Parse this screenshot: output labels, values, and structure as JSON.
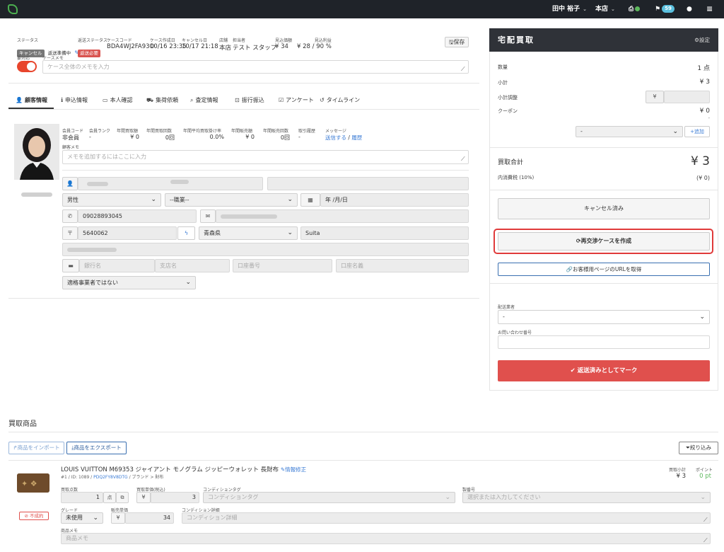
{
  "topbar": {
    "user": "田中 裕子",
    "store": "本店",
    "notify_count": "59"
  },
  "case": {
    "status_label": "ステータス",
    "status_badge": "キャンセル",
    "status_text": "返送準備中",
    "return_status_label": "返送ステータス",
    "return_badge": "返送必要",
    "case_code_label": "ケースコード",
    "case_code": "BDA4WJ2FA93O",
    "created_label": "ケース作成日",
    "created": "10/16 23:35",
    "cancel_label": "キャンセル日",
    "cancel": "10/17 21:18",
    "store_label": "店舗",
    "store": "本店",
    "staff_label": "担当者",
    "staff": "テスト スタッフ",
    "estimate_label": "見込価額",
    "estimate": "¥ 34",
    "estimate_profit_label": "見込利益",
    "estimate_profit": "¥ 28 / 90 %",
    "save_button": "保存",
    "needs_action_label": "要対応",
    "memo_label": "ケースメモ",
    "memo_placeholder": "ケース全体のメモを入力"
  },
  "tabs": [
    "顧客情報",
    "申込情報",
    "本人確認",
    "集荷依頼",
    "査定情報",
    "振行振込",
    "アンケート",
    "タイムライン"
  ],
  "customer": {
    "member_code_label": "会員コード",
    "member_code": "非会員",
    "member_rank_label": "会員ランク",
    "member_rank": "-",
    "yearly_buy_amount_label": "年間買取額",
    "yearly_buy_amount": "¥ 0",
    "yearly_buy_count_label": "年間買取回数",
    "yearly_buy_count": "0回",
    "avg_rate_label": "年間平均買取掛け率",
    "avg_rate": "0.0%",
    "yearly_sale_amount_label": "年間販売額",
    "yearly_sale_amount": "¥ 0",
    "yearly_sale_count_label": "年間販売回数",
    "yearly_sale_count": "0回",
    "history_label": "取引履歴",
    "history": "-",
    "message_label": "メッセージ",
    "message_send": "送信する",
    "message_sep": "/",
    "message_history": "履歴",
    "memo_label": "顧客メモ",
    "memo_placeholder": "メモを追加するにはここに入力",
    "gender": "男性",
    "occupation": "--職業--",
    "birthday_placeholder": "年 /月/日",
    "phone": "09028893045",
    "zip": "5640062",
    "prefecture": "青森県",
    "city": "Suita",
    "bank_name_placeholder": "銀行名",
    "branch_placeholder": "支店名",
    "account_no_placeholder": "口座番号",
    "account_name_placeholder": "口座名義",
    "business_select": "適格事業者ではない"
  },
  "right_panel": {
    "title": "宅配買取",
    "settings": "設定",
    "quantity_label": "数量",
    "quantity": "1 点",
    "subtotal_label": "小計",
    "subtotal": "¥ 3",
    "adjust_label": "小計調整",
    "adjust_prefix": "¥",
    "coupon_label": "クーポン",
    "coupon": "¥ 0",
    "coupon_dash": "-",
    "coupon_select": "-",
    "add_button": "追加",
    "total_label": "買取合計",
    "total": "¥ 3",
    "tax_label": "内消費税 (10%)",
    "tax": "(¥ 0)",
    "cancelled_button": "キャンセル済み",
    "recreate_button": "再交渉ケースを作成",
    "url_button": "お客様用ページのURLを取得",
    "carrier_label": "配送業者",
    "carrier_value": "-",
    "tracking_label": "お問い合わせ番号",
    "mark_returned_button": "返送済みとしてマーク"
  },
  "products": {
    "section_title": "買取商品",
    "import_button": "商品をインポート",
    "export_button": "商品をエクスポート",
    "filter_button": "絞り込み",
    "item": {
      "title": "LOUIS VUITTON M69353 ジャイアント モノグラム ジッピーウォレット 長財布",
      "edit_link": "情報修正",
      "meta_prefix": "#1 / ID: 1089 /",
      "meta_code": "PDQ2FY8V8DTG",
      "meta_suffix": "/ ブランド > 財布",
      "subtotal_label": "買取小計",
      "subtotal": "¥ 3",
      "points_label": "ポイント",
      "points": "0 pt",
      "status_badge": "不成約",
      "qty_label": "買取点数",
      "qty": "1",
      "qty_unit": "点",
      "unit_price_label": "買取単価(税込)",
      "unit_price": "3",
      "yen": "¥",
      "condition_tag_label": "コンディションタグ",
      "condition_tag_placeholder": "コンディションタグ",
      "serial_label": "製番号",
      "serial_placeholder": "選択または入力してください",
      "grade_label": "グレード",
      "grade": "未使用",
      "sale_price_label": "販売単価",
      "sale_price": "34",
      "condition_detail_label": "コンディション詳細",
      "condition_detail_placeholder": "コンディション詳細",
      "memo_label": "商品メモ",
      "memo_placeholder": "商品メモ"
    }
  },
  "colors": {
    "topbar": "#1f2329",
    "panel_header": "#2f3238",
    "danger": "#e0504d",
    "link": "#3a7bd5",
    "toggle": "#e8452c",
    "highlight_border": "#e03a3a"
  }
}
